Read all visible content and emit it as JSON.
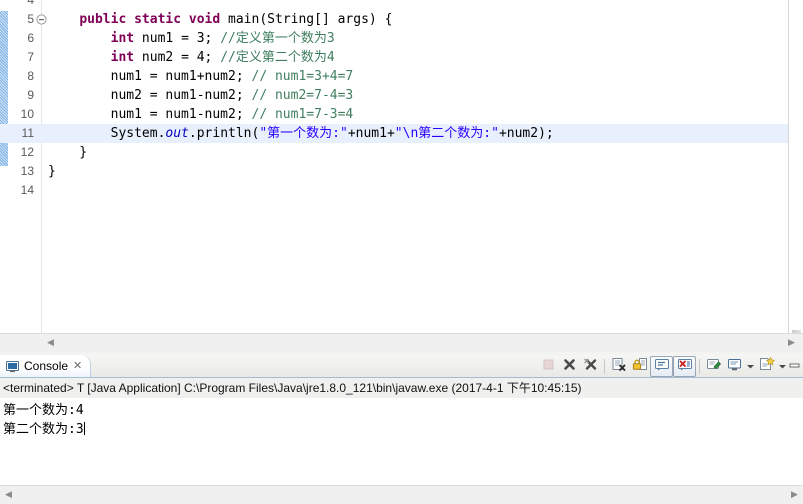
{
  "editor": {
    "first_visible_line": 4,
    "highlighted_line": 11,
    "change_bar_lines": "5-12",
    "lines": [
      {
        "num": "4",
        "fold": false,
        "indent": 0,
        "segments": []
      },
      {
        "num": "5",
        "fold": true,
        "indent": 0,
        "segments": [
          {
            "t": "    ",
            "c": "pln"
          },
          {
            "t": "public static void ",
            "c": "kw"
          },
          {
            "t": "main(String[] args) {",
            "c": "pln"
          }
        ]
      },
      {
        "num": "6",
        "fold": false,
        "indent": 0,
        "segments": [
          {
            "t": "        ",
            "c": "pln"
          },
          {
            "t": "int",
            "c": "kw"
          },
          {
            "t": " num1 = 3; ",
            "c": "pln"
          },
          {
            "t": "//定义第一个数为3",
            "c": "cm"
          }
        ]
      },
      {
        "num": "7",
        "fold": false,
        "indent": 0,
        "segments": [
          {
            "t": "        ",
            "c": "pln"
          },
          {
            "t": "int",
            "c": "kw"
          },
          {
            "t": " num2 = 4; ",
            "c": "pln"
          },
          {
            "t": "//定义第二个数为4",
            "c": "cm"
          }
        ]
      },
      {
        "num": "8",
        "fold": false,
        "indent": 0,
        "segments": [
          {
            "t": "        num1 = num1+num2; ",
            "c": "pln"
          },
          {
            "t": "// num1=3+4=7",
            "c": "cm"
          }
        ]
      },
      {
        "num": "9",
        "fold": false,
        "indent": 0,
        "segments": [
          {
            "t": "        num2 = num1-num2; ",
            "c": "pln"
          },
          {
            "t": "// num2=7-4=3",
            "c": "cm"
          }
        ]
      },
      {
        "num": "10",
        "fold": false,
        "indent": 0,
        "segments": [
          {
            "t": "        num1 = num1-num2; ",
            "c": "pln"
          },
          {
            "t": "// num1=7-3=4",
            "c": "cm"
          }
        ]
      },
      {
        "num": "11",
        "fold": false,
        "indent": 0,
        "highlight": true,
        "segments": [
          {
            "t": "        System.",
            "c": "pln"
          },
          {
            "t": "out",
            "c": "fld"
          },
          {
            "t": ".println(",
            "c": "pln"
          },
          {
            "t": "\"第一个数为:\"",
            "c": "str"
          },
          {
            "t": "+num1+",
            "c": "pln"
          },
          {
            "t": "\"\\n第二个数为:\"",
            "c": "str"
          },
          {
            "t": "+num2);",
            "c": "pln"
          }
        ]
      },
      {
        "num": "12",
        "fold": false,
        "indent": 0,
        "segments": [
          {
            "t": "    }",
            "c": "pln"
          }
        ]
      },
      {
        "num": "13",
        "fold": false,
        "indent": 0,
        "segments": [
          {
            "t": "}",
            "c": "pln"
          }
        ]
      },
      {
        "num": "14",
        "fold": false,
        "indent": 0,
        "segments": []
      }
    ],
    "hscroll": {
      "left_arrow": "◀",
      "right_arrow": "▶"
    }
  },
  "console": {
    "tab": {
      "label": "Console",
      "close_glyph": "✕",
      "icon": "console-monitor-icon"
    },
    "toolbar": [
      {
        "name": "terminate-button",
        "icon": "stop-square-icon",
        "enabled": false,
        "boxed": false
      },
      {
        "name": "remove-launch-button",
        "icon": "remove-x-icon",
        "enabled": true,
        "boxed": false
      },
      {
        "name": "remove-all-terminated-button",
        "icon": "remove-all-x-icon",
        "enabled": true,
        "boxed": false
      },
      {
        "name": "separator-1",
        "icon": "separator",
        "enabled": false,
        "boxed": false
      },
      {
        "name": "clear-console-button",
        "icon": "clear-console-icon",
        "enabled": true,
        "boxed": false
      },
      {
        "name": "scroll-lock-button",
        "icon": "scroll-lock-icon",
        "enabled": true,
        "boxed": false
      },
      {
        "name": "show-console-on-output-button",
        "icon": "show-console-out-icon",
        "enabled": true,
        "boxed": true
      },
      {
        "name": "show-console-on-error-button",
        "icon": "show-console-err-icon",
        "enabled": true,
        "boxed": true
      },
      {
        "name": "separator-2",
        "icon": "separator",
        "enabled": false,
        "boxed": false
      },
      {
        "name": "pin-console-button",
        "icon": "pin-console-icon",
        "enabled": true,
        "boxed": false
      },
      {
        "name": "display-selected-console-button",
        "icon": "display-console-icon",
        "enabled": true,
        "boxed": false
      },
      {
        "name": "display-console-menu-arrow",
        "icon": "chevron-down-icon",
        "enabled": true,
        "boxed": false
      },
      {
        "name": "open-console-button",
        "icon": "new-console-icon",
        "enabled": true,
        "boxed": false
      },
      {
        "name": "open-console-menu-arrow",
        "icon": "chevron-down-icon",
        "enabled": true,
        "boxed": false
      },
      {
        "name": "minimize-view-button",
        "icon": "minimize-icon",
        "enabled": true,
        "boxed": false
      }
    ],
    "status_line": "<terminated> T [Java Application] C:\\Program Files\\Java\\jre1.8.0_121\\bin\\javaw.exe (2017-4-1 下午10:45:15)",
    "output": [
      "第一个数为:4",
      "第二个数为:3"
    ],
    "hscroll": {
      "left_arrow": "◀",
      "right_arrow": "▶"
    }
  },
  "colors": {
    "keyword": "#7f0055",
    "comment": "#3f7f5f",
    "string": "#2a00ff",
    "static_field": "#0000c0",
    "selected_line": "#e8f0fe",
    "change_bar": "#a8cdee",
    "tab_border": "#a3bdd4"
  }
}
